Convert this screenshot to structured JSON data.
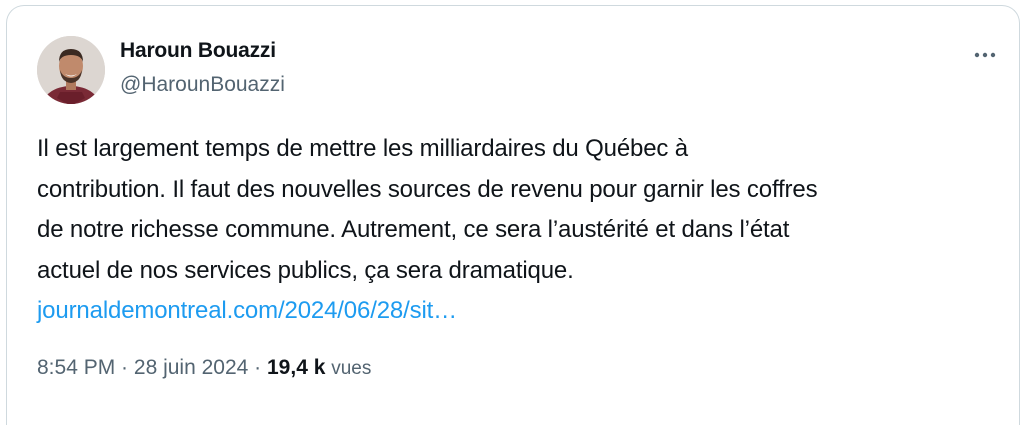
{
  "author": {
    "display_name": "Haroun Bouazzi",
    "handle": "@HarounBouazzi",
    "avatar_icon": "profile-photo"
  },
  "more_button": {
    "icon": "more-horizontal-icon"
  },
  "tweet": {
    "lines": [
      "Il est largement temps de mettre les milliardaires du Québec à",
      "contribution. Il faut des nouvelles sources de revenu pour garnir les coffres",
      "de notre richesse commune. Autrement, ce sera l’austérité et dans l’état",
      "actuel de nos services publics, ça sera dramatique."
    ],
    "link_text": "journaldemontreal.com/2024/06/28/sit…"
  },
  "meta": {
    "time": "8:54 PM",
    "separator1": " · ",
    "date": "28 juin 2024",
    "separator2": " · ",
    "views_count": "19,4 k",
    "views_label": "vues"
  },
  "colors": {
    "text": "#0f1419",
    "secondary": "#536471",
    "link": "#1d9bf0",
    "border": "#cfd9de"
  }
}
